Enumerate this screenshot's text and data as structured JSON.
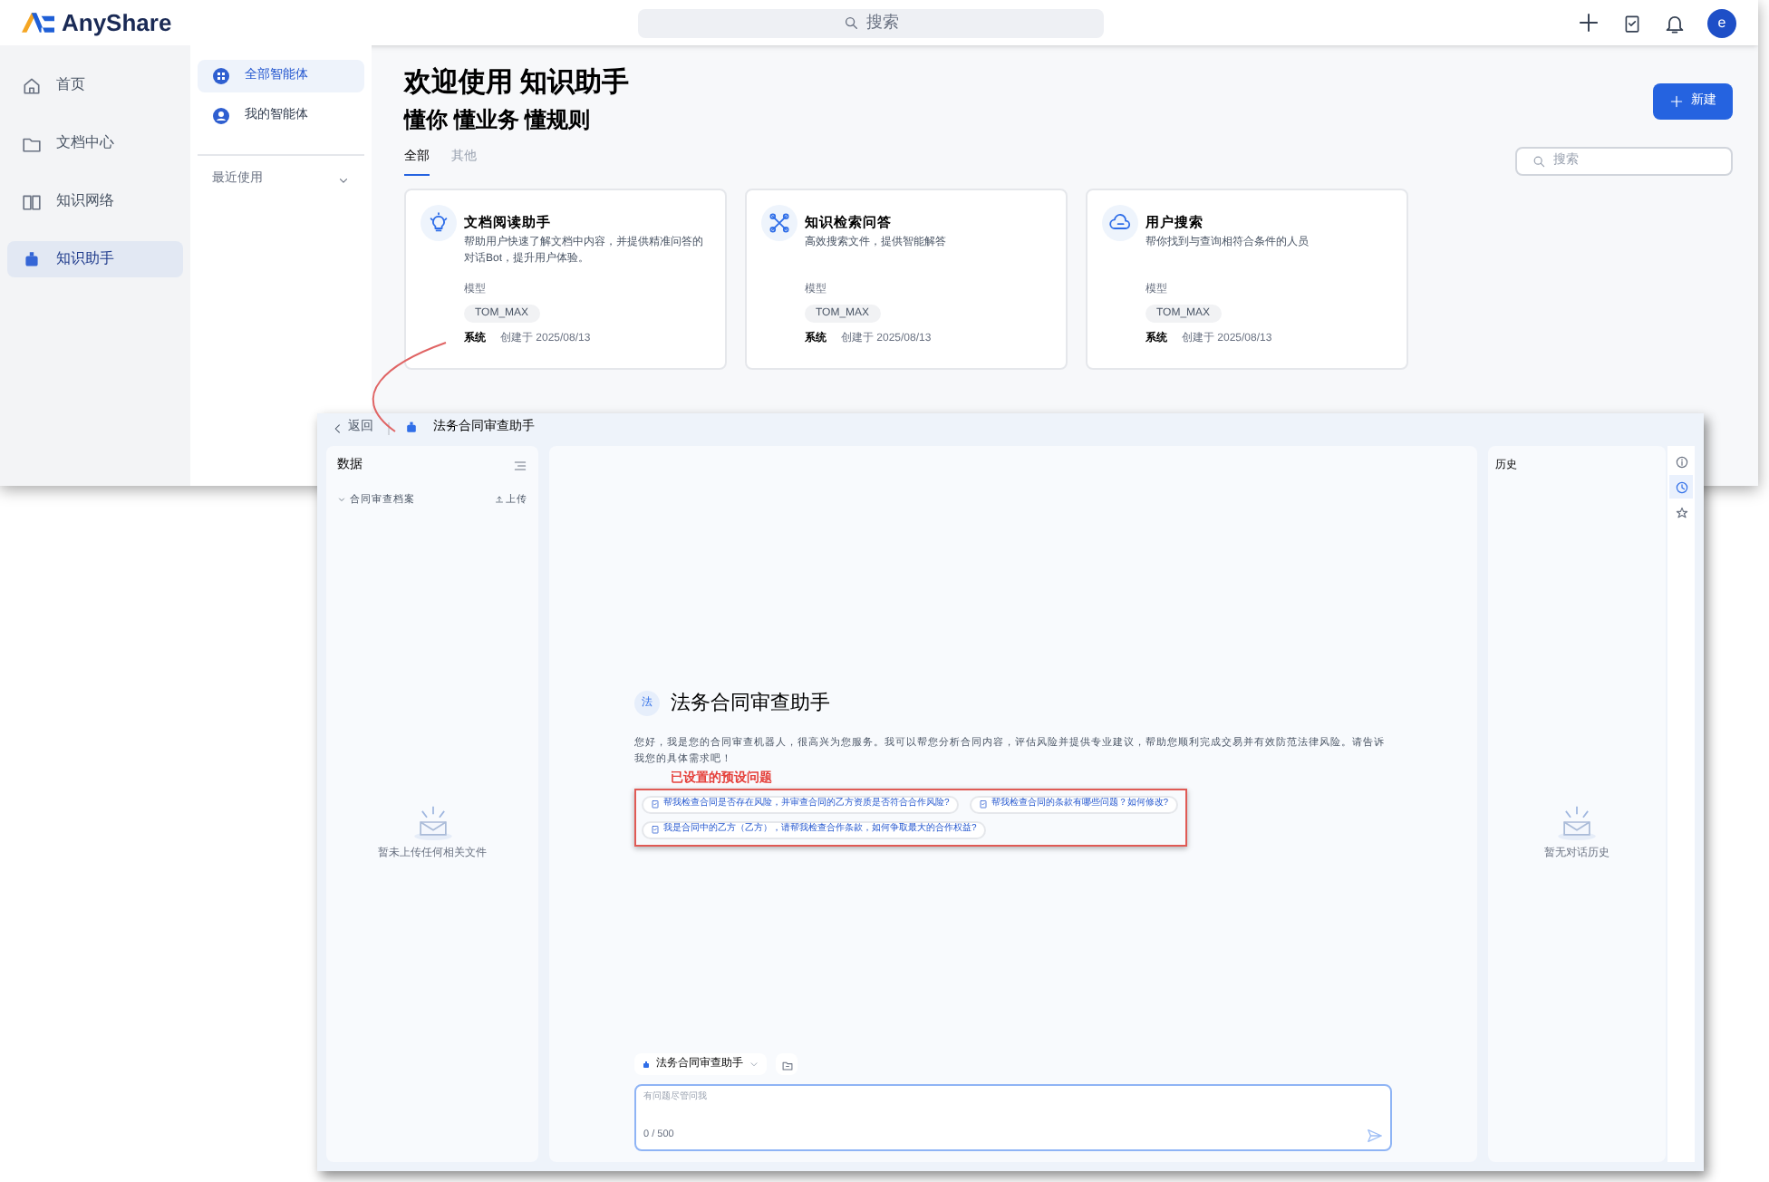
{
  "back_window": {
    "brand": "AnyShare",
    "search": {
      "placeholder": "搜索"
    },
    "avatar": "e",
    "nav": [
      {
        "label": "首页",
        "selected": false
      },
      {
        "label": "文档中心",
        "selected": false
      },
      {
        "label": "知识网络",
        "selected": false
      },
      {
        "label": "知识助手",
        "selected": true
      }
    ],
    "subnav": [
      {
        "label": "全部智能体",
        "selected": true
      },
      {
        "label": "我的智能体",
        "selected": false
      }
    ],
    "recent": "最近使用",
    "welcome": "欢迎使用 **知识助手**",
    "slogan": "懂你 懂业务 懂规则",
    "new_button": "新建",
    "tabs": [
      {
        "label": "全部",
        "selected": true
      },
      {
        "label": "其他",
        "selected": false
      }
    ],
    "filter": {
      "placeholder": "搜索"
    },
    "cards": [
      {
        "title": "文档阅读助手",
        "desc": "帮助用户快速了解文档中内容，并提供精准问答的对话Bot，提升用户体验。",
        "label": "模型",
        "tag": "TOM_MAX",
        "owner": "系统",
        "created": "创建于 2025/08/13"
      },
      {
        "title": "知识检索问答",
        "desc": "高效搜索文件，提供智能解答",
        "label": "模型",
        "tag": "TOM_MAX",
        "owner": "系统",
        "created": "创建于 2025/08/13"
      },
      {
        "title": "用户搜索",
        "desc": "帮你找到与查询相符合条件的人员",
        "label": "模型",
        "tag": "TOM_MAX",
        "owner": "系统",
        "created": "创建于 2025/08/13"
      }
    ]
  },
  "front_window": {
    "back": "返回",
    "title": "法务合同审查助手",
    "data_panel": {
      "title": "数据",
      "folder": "合同审查档案",
      "upload": "上传",
      "empty": "暂未上传任何相关文件"
    },
    "chat": {
      "avatar": "法",
      "title": "法务合同审查助手",
      "intro": "您好，我是您的合同审查机器人，很高兴为您服务。我可以帮您分析合同内容，评估风险并提供专业建议，帮助您顺利完成交易并有效防范法律风险。请告诉我您的具体需求吧！",
      "annotation": "已设置的预设问题",
      "suggestions": [
        "帮我检查合同是否存在风险，并审查合同的乙方资质是否符合合作风险?",
        "帮我检查合同的条款有哪些问题？如何修改?",
        "我是合同中的乙方（乙方），请帮我检查合作条款，如何争取最大的合作权益?"
      ],
      "agent": "法务合同审查助手",
      "placeholder": "有问题尽管问我",
      "counter": "0 / 500"
    },
    "history": {
      "title": "历史",
      "empty": "暂无对话历史"
    },
    "side_icons": [
      {
        "selected": false
      },
      {
        "selected": true
      },
      {
        "selected": false
      }
    ]
  }
}
